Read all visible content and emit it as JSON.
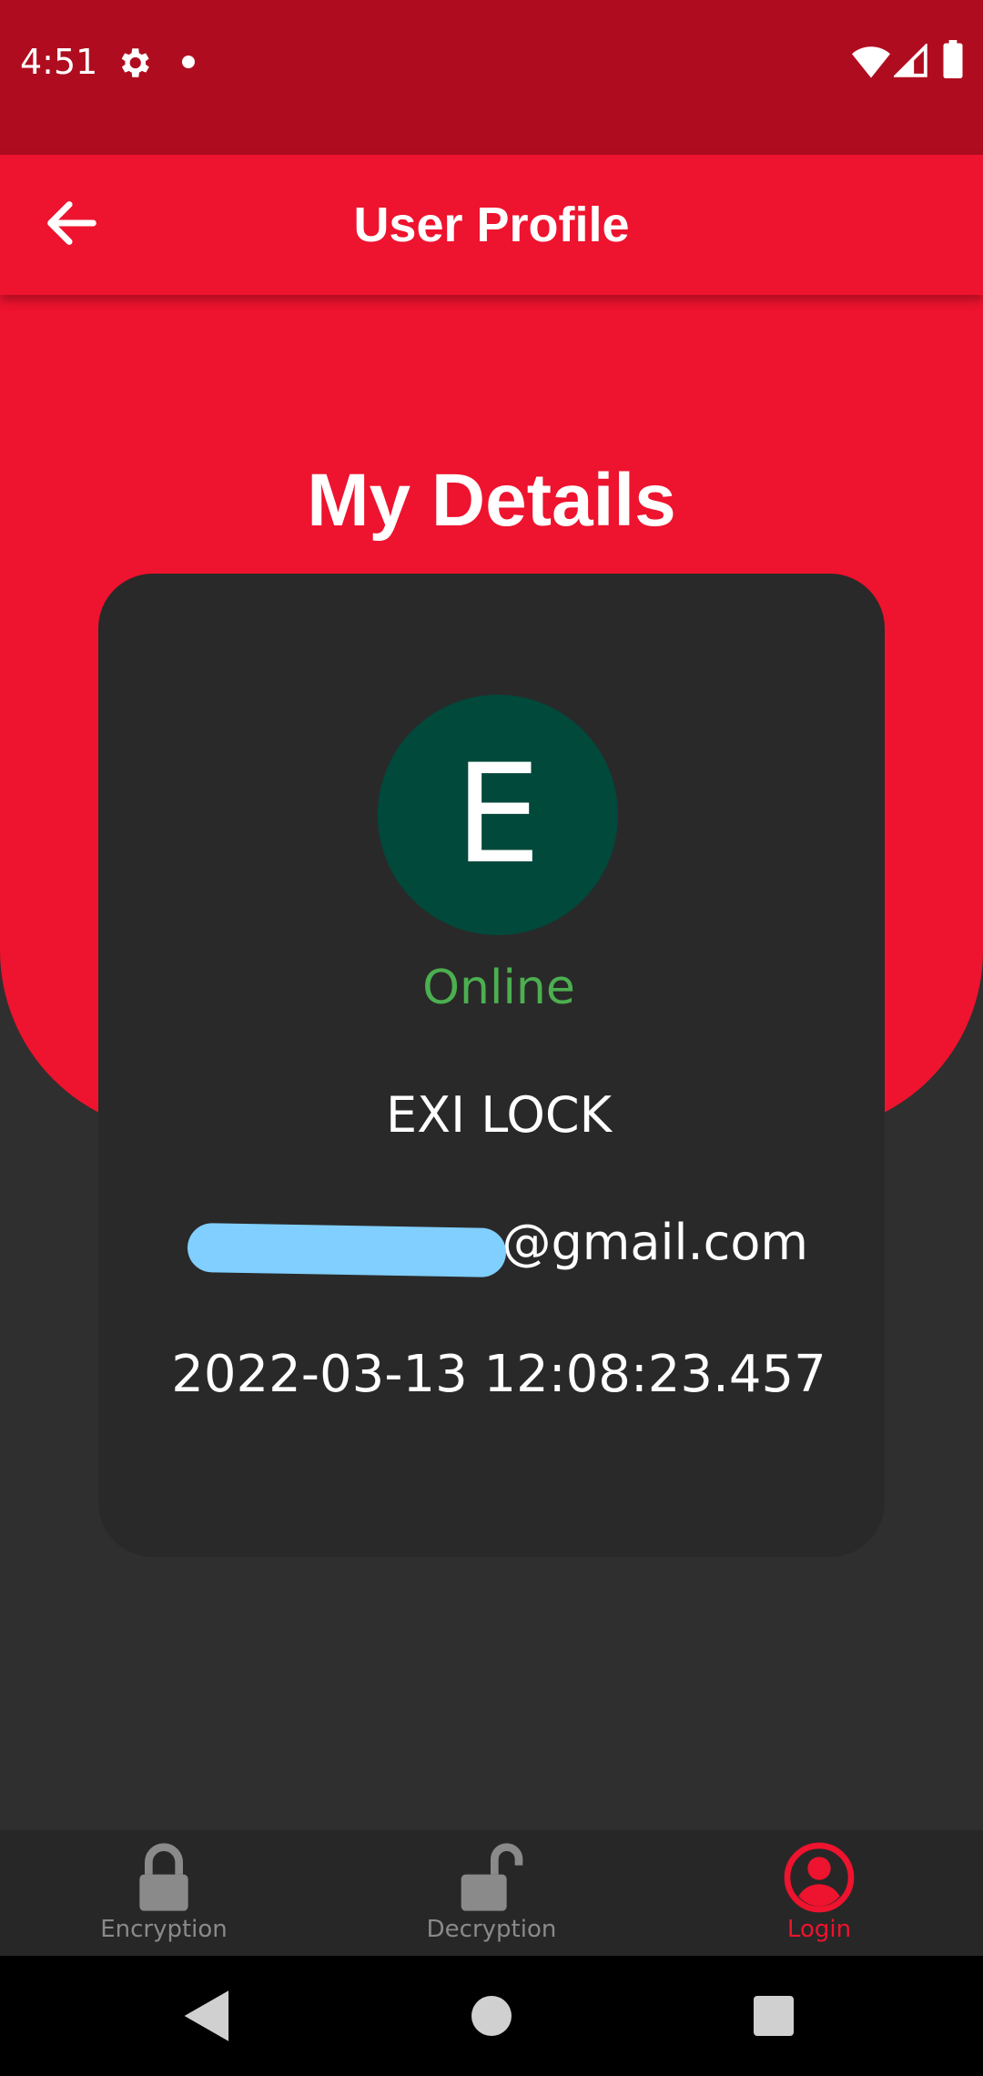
{
  "status_bar": {
    "time": "4:51",
    "icons": [
      "gear-icon",
      "notification-dot",
      "wifi-icon",
      "signal-icon",
      "battery-icon"
    ]
  },
  "app_bar": {
    "title": "User Profile",
    "back_icon": "arrow-left-icon"
  },
  "hero": {
    "title": "My Details"
  },
  "profile": {
    "avatar_initial": "E",
    "status": "Online",
    "name": "EXI LOCK",
    "email": "@gmail.com",
    "timestamp": "2022-03-13 12:08:23.457"
  },
  "bottom_nav": {
    "items": [
      {
        "label": "Encryption",
        "icon": "lock-closed-icon",
        "active": false
      },
      {
        "label": "Decryption",
        "icon": "lock-open-icon",
        "active": false
      },
      {
        "label": "Login",
        "icon": "account-circle-icon",
        "active": true
      }
    ]
  },
  "colors": {
    "status_bar": "#af0d1f",
    "primary": "#ee132e",
    "card": "#292929",
    "background": "#2f2f2f",
    "avatar": "#00493b",
    "online": "#4caf50",
    "nav_inactive": "#8a8a8a",
    "nav_active": "#ee132e",
    "redaction": "#80cfff"
  }
}
